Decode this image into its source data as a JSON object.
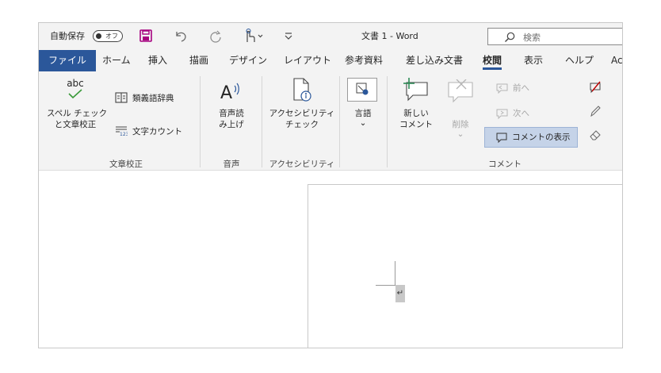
{
  "titlebar": {
    "autosave_label": "自動保存",
    "autosave_toggle": "オフ",
    "doc_title": "文書 1  -  Word",
    "search_placeholder": "検索"
  },
  "tabs": [
    "ファイル",
    "ホーム",
    "挿入",
    "描画",
    "デザイン",
    "レイアウト",
    "参考資料",
    "差し込み文書",
    "校閲",
    "表示",
    "ヘルプ",
    "Ac"
  ],
  "active_tab": "校閲",
  "ribbon": {
    "proofing": {
      "abc": "abc",
      "spelling_line1": "スペル チェック",
      "spelling_line2": "と文章校正",
      "thesaurus": "類義語辞典",
      "word_count": "文字カウント",
      "label": "文章校正"
    },
    "speech": {
      "read_aloud_line1": "音声読",
      "read_aloud_line2": "み上げ",
      "label": "音声"
    },
    "accessibility": {
      "check_line1": "アクセシビリティ",
      "check_line2": "チェック",
      "label": "アクセシビリティ"
    },
    "language": {
      "language_btn": "言語",
      "chevron": "⌄"
    },
    "comments": {
      "new_line1": "新しい",
      "new_line2": "コメント",
      "delete": "削除",
      "delete_chevron": "⌄",
      "previous": "前へ",
      "next": "次へ",
      "show_comments": "コメントの表示",
      "label": "コメント"
    }
  },
  "document": {
    "paragraph_mark": "↵"
  },
  "colors": {
    "accent": "#2b579a",
    "save_icon": "#a6007f",
    "abc_check": "#3a9a3a",
    "toggle_on_area": "#c5d3e8",
    "new_comment_plus": "#2e8b57",
    "erase_red": "#c00000"
  }
}
